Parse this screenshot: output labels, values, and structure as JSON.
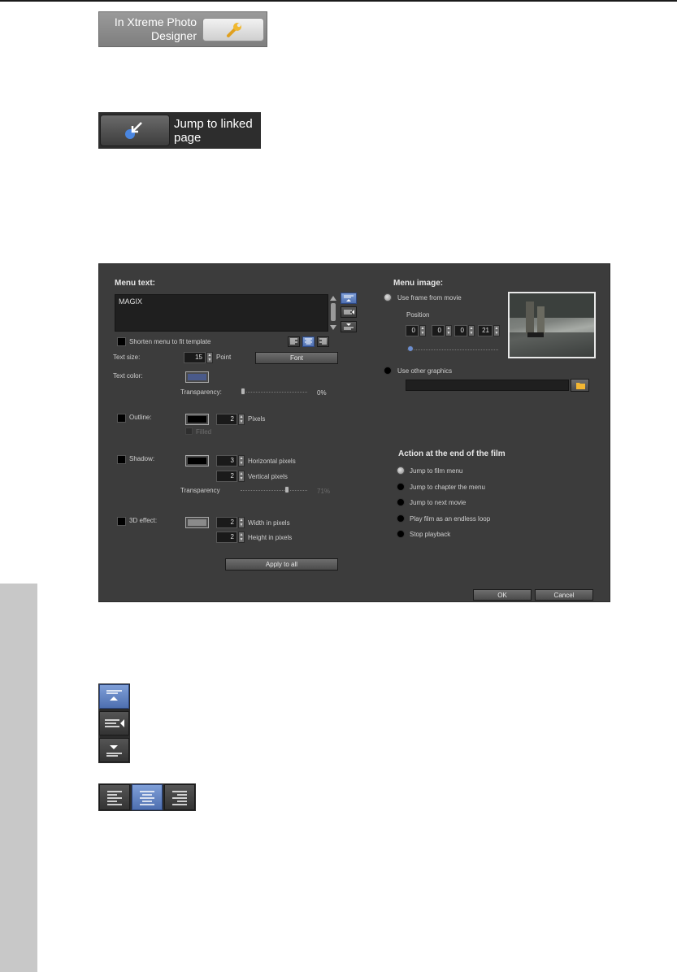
{
  "snippet_xpd": {
    "text_line1": "In Xtreme Photo",
    "text_line2": "Designer",
    "button_icon": "wrench-icon"
  },
  "snippet_jump": {
    "text_line1": "Jump to linked",
    "text_line2": "page",
    "button_icon": "jump-link-icon"
  },
  "dialog": {
    "menu_text_heading": "Menu text:",
    "menu_text_value": "MAGIX",
    "shorten_label": "Shorten menu to fit template",
    "text_size_label": "Text size:",
    "text_size_value": "15",
    "point_label": "Point",
    "font_button": "Font",
    "text_color_label": "Text color:",
    "text_color": "#4a5a8a",
    "transparency_label": "Transparency:",
    "transparency_value": "0%",
    "transparency_level": 0,
    "outline_label": "Outline:",
    "outline_color": "#000000",
    "outline_pixels": "2",
    "pixels_label": "Pixels",
    "filled_label": "Filled",
    "shadow_label": "Shadow:",
    "shadow_color": "#000000",
    "shadow_h": "3",
    "shadow_h_label": "Horizontal pixels",
    "shadow_v": "2",
    "shadow_v_label": "Vertical pixels",
    "shadow_transparency_label": "Transparency",
    "shadow_transparency_value": "71%",
    "shadow_transparency_level": 0.71,
    "effect3d_label": "3D effect:",
    "effect3d_color": "#8a8a8a",
    "effect3d_w": "2",
    "effect3d_w_label": "Width in pixels",
    "effect3d_h": "2",
    "effect3d_h_label": "Height in pixels",
    "apply_all_button": "Apply to all",
    "menu_image_heading": "Menu image:",
    "use_frame_label": "Use frame from movie",
    "position_label": "Position",
    "position_values": [
      "0",
      "0",
      "0",
      "21"
    ],
    "position_level": 0,
    "use_other_label": "Use other graphics",
    "action_heading": "Action at the end of the film",
    "actions": [
      {
        "label": "Jump to film menu",
        "selected": true
      },
      {
        "label": "Jump to chapter the menu",
        "selected": false
      },
      {
        "label": "Jump to next movie",
        "selected": false
      },
      {
        "label": "Play film as an endless loop",
        "selected": false
      },
      {
        "label": "Stop playback",
        "selected": false
      }
    ],
    "ok_button": "OK",
    "cancel_button": "Cancel"
  },
  "icon_strip_vertical": [
    "align-top-icon",
    "align-middle-icon",
    "align-bottom-icon"
  ],
  "icon_strip_horizontal": [
    "align-left-icon",
    "align-center-icon",
    "align-right-icon"
  ]
}
